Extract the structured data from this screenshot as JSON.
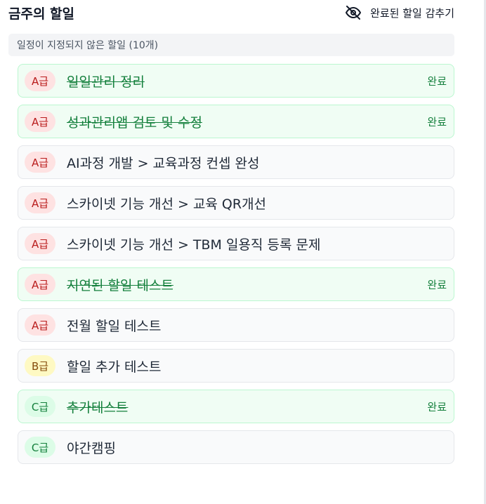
{
  "header": {
    "title": "금주의 할일",
    "hide_completed_label": "완료된 할일 감추기",
    "hide_icon": "eye-off-icon"
  },
  "section": {
    "label": "일정이 지정되지 않은 할일 (10개)"
  },
  "tasks": [
    {
      "grade": "A급",
      "level": "A",
      "title": "일일관리 정리",
      "completed": true,
      "status": "완료"
    },
    {
      "grade": "A급",
      "level": "A",
      "title": "성과관리앱 검토 및 수정",
      "completed": true,
      "status": "완료"
    },
    {
      "grade": "A급",
      "level": "A",
      "title": "AI과정 개발 > 교육과정 컨셉 완성",
      "completed": false,
      "status": ""
    },
    {
      "grade": "A급",
      "level": "A",
      "title": "스카이넷 기능 개선 > 교육 QR개선",
      "completed": false,
      "status": ""
    },
    {
      "grade": "A급",
      "level": "A",
      "title": "스카이넷 기능 개선 > TBM 일용직 등록 문제",
      "completed": false,
      "status": ""
    },
    {
      "grade": "A급",
      "level": "A",
      "title": "지연된 할일 테스트",
      "completed": true,
      "status": "완료"
    },
    {
      "grade": "A급",
      "level": "A",
      "title": "전월 할일 테스트",
      "completed": false,
      "status": ""
    },
    {
      "grade": "B급",
      "level": "B",
      "title": "할일 추가 테스트",
      "completed": false,
      "status": ""
    },
    {
      "grade": "C급",
      "level": "C",
      "title": "추가테스트",
      "completed": true,
      "status": "완료"
    },
    {
      "grade": "C급",
      "level": "C",
      "title": "야간캠핑",
      "completed": false,
      "status": ""
    }
  ],
  "colors": {
    "grade_A_bg": "#fee2e2",
    "grade_B_bg": "#fef9c3",
    "grade_C_bg": "#dcfce7",
    "done_bg": "#f0fdf4",
    "done_text": "#15803d"
  }
}
